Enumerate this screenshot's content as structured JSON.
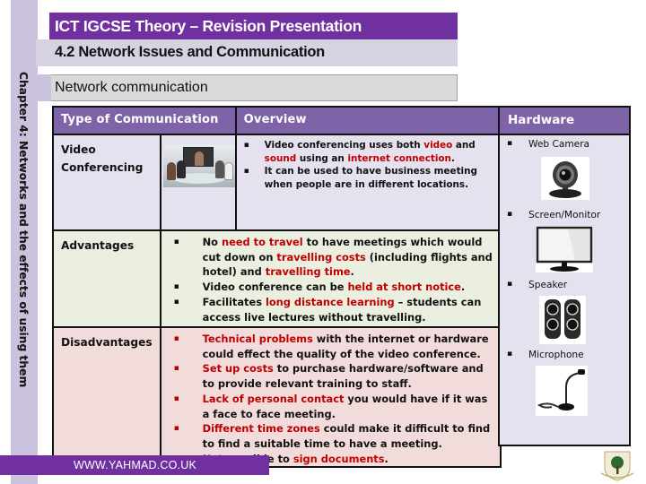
{
  "slide": {
    "title": "ICT IGCSE Theory – Revision Presentation",
    "subtitle": "4.2 Network Issues and Communication",
    "section": "Network communication",
    "side_label": "Chapter 4: Networks and the effects of using them",
    "footer": "WWW.YAHMAD.CO.UK",
    "crest_icon": "school-crest-logo"
  },
  "colors": {
    "title_purple": "#7030a0",
    "header_purple": "#7e63a8",
    "highlight_red": "#c00000",
    "video_row_bg": "#e5e1ee",
    "advantages_row_bg": "#ebefe0",
    "disadvantages_row_bg": "#f2dcdb"
  },
  "table": {
    "headers": {
      "type": "Type of Communication",
      "overview": "Overview",
      "hardware": "Hardware"
    },
    "video": {
      "label": "Video Conferencing",
      "image_icon": "video-conference-photo",
      "overview": [
        [
          {
            "t": "Video conferencing uses both ",
            "hl": false
          },
          {
            "t": "video",
            "hl": true
          },
          {
            "t": " and ",
            "hl": false
          },
          {
            "t": "sound",
            "hl": true
          },
          {
            "t": " using an ",
            "hl": false
          },
          {
            "t": "internet connection",
            "hl": true
          },
          {
            "t": ".",
            "hl": false
          }
        ],
        [
          {
            "t": "It can be used to have business meeting when people are in different locations.",
            "hl": false
          }
        ]
      ]
    },
    "advantages": {
      "label": "Advantages",
      "items": [
        [
          {
            "t": "No ",
            "hl": false
          },
          {
            "t": "need to travel",
            "hl": true
          },
          {
            "t": " to have meetings which would cut down on ",
            "hl": false
          },
          {
            "t": "travelling costs",
            "hl": true
          },
          {
            "t": " (including flights and hotel) and ",
            "hl": false
          },
          {
            "t": "travelling time",
            "hl": true
          },
          {
            "t": ".",
            "hl": false
          }
        ],
        [
          {
            "t": "Video conference can be ",
            "hl": false
          },
          {
            "t": "held at short notice",
            "hl": true
          },
          {
            "t": ".",
            "hl": false
          }
        ],
        [
          {
            "t": "Facilitates ",
            "hl": false
          },
          {
            "t": "long distance learning",
            "hl": true
          },
          {
            "t": " – students can access live lectures without travelling.",
            "hl": false
          }
        ]
      ]
    },
    "disadvantages": {
      "label": "Disadvantages",
      "items": [
        [
          {
            "t": "Technical problems",
            "hl": true
          },
          {
            "t": " with the internet or hardware could effect the quality of the video conference.",
            "hl": false
          }
        ],
        [
          {
            "t": "Set up costs",
            "hl": true
          },
          {
            "t": " to purchase hardware/software and to provide relevant training to staff.",
            "hl": false
          }
        ],
        [
          {
            "t": "Lack of personal contact",
            "hl": true
          },
          {
            "t": " you would have if it was a face to face meeting.",
            "hl": false
          }
        ],
        [
          {
            "t": "Different time zones",
            "hl": true
          },
          {
            "t": " could make it difficult to find to find a suitable time to have a meeting.",
            "hl": false
          }
        ],
        [
          {
            "t": "Not possible to ",
            "hl": false
          },
          {
            "t": "sign documents",
            "hl": true
          },
          {
            "t": ".",
            "hl": false
          }
        ]
      ]
    },
    "hardware": [
      {
        "label": "Web Camera",
        "icon": "webcam-icon"
      },
      {
        "label": "Screen/Monitor",
        "icon": "monitor-icon"
      },
      {
        "label": "Speaker",
        "icon": "speaker-icon"
      },
      {
        "label": "Microphone",
        "icon": "microphone-icon"
      }
    ]
  }
}
